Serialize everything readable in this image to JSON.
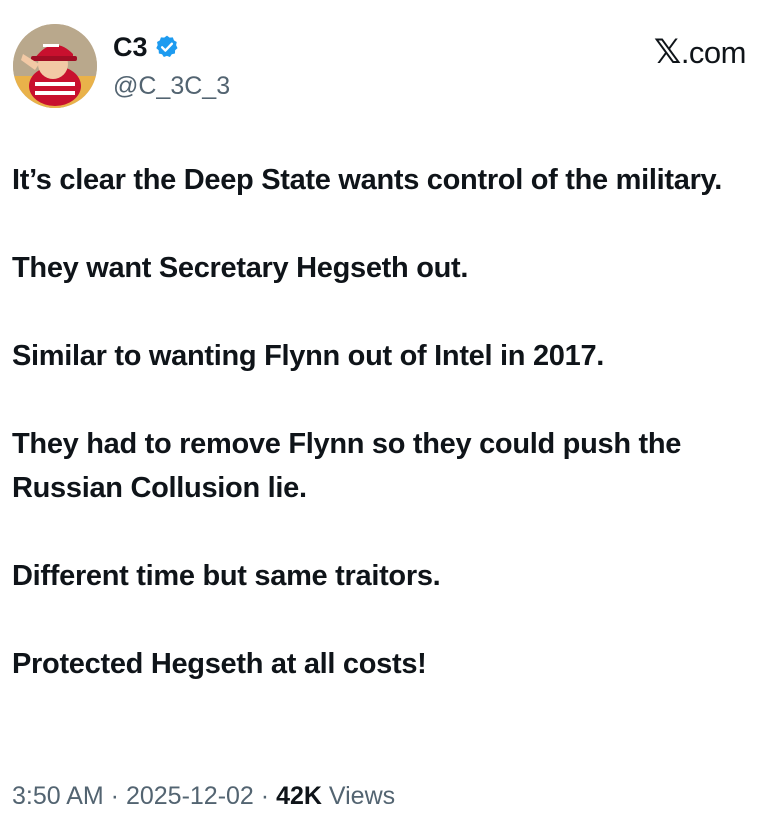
{
  "author": {
    "display_name": "C3",
    "handle": "@C_3C_3",
    "verified_icon": "verified-badge-icon",
    "avatar_icon": "avatar-photo"
  },
  "brand": {
    "label": ".com",
    "x_glyph": "𝕏"
  },
  "post": {
    "paragraphs": [
      "It’s clear the Deep State wants control of the military.",
      "They want Secretary Hegseth out.",
      "Similar to wanting Flynn out of Intel in 2017.",
      "They had to remove Flynn so they could push the Russian Collusion lie.",
      "Different time but same traitors.",
      "Protected Hegseth at all costs!"
    ]
  },
  "meta": {
    "time": "3:50 AM",
    "separator": " · ",
    "date": "2025-12-02",
    "views_count": "42K",
    "views_label": " Views"
  },
  "colors": {
    "text": "#0f1419",
    "secondary": "#536471",
    "verified": "#1d9bf0",
    "hat": "#c8102e"
  }
}
